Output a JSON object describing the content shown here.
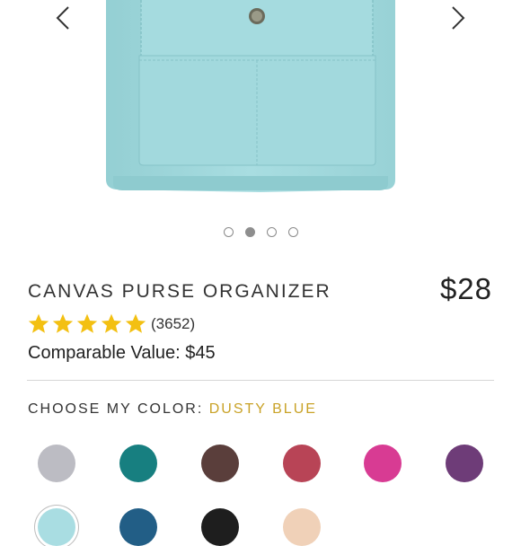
{
  "gallery": {
    "image_alt": "Canvas purse organizer in dusty blue",
    "photo_color": "#a7dde0",
    "slide_count": 4,
    "active_slide": 2
  },
  "product": {
    "title": "CANVAS PURSE ORGANIZER",
    "price": "$28",
    "rating": {
      "stars": 5,
      "max": 5,
      "review_count": "(3652)",
      "star_color": "#f3c012"
    },
    "comparable_value": "Comparable Value: $45"
  },
  "color_picker": {
    "label": "CHOOSE MY COLOR: ",
    "selected": "DUSTY BLUE",
    "accent_color": "#c9a227",
    "swatches": [
      "#bcbcc3",
      "#177f80",
      "#5a3e3b",
      "#b84456",
      "#d83b93",
      "#6e3c78",
      "#a9dde2",
      "#225e86",
      "#1e1e1e",
      "#f0d1b8"
    ]
  }
}
